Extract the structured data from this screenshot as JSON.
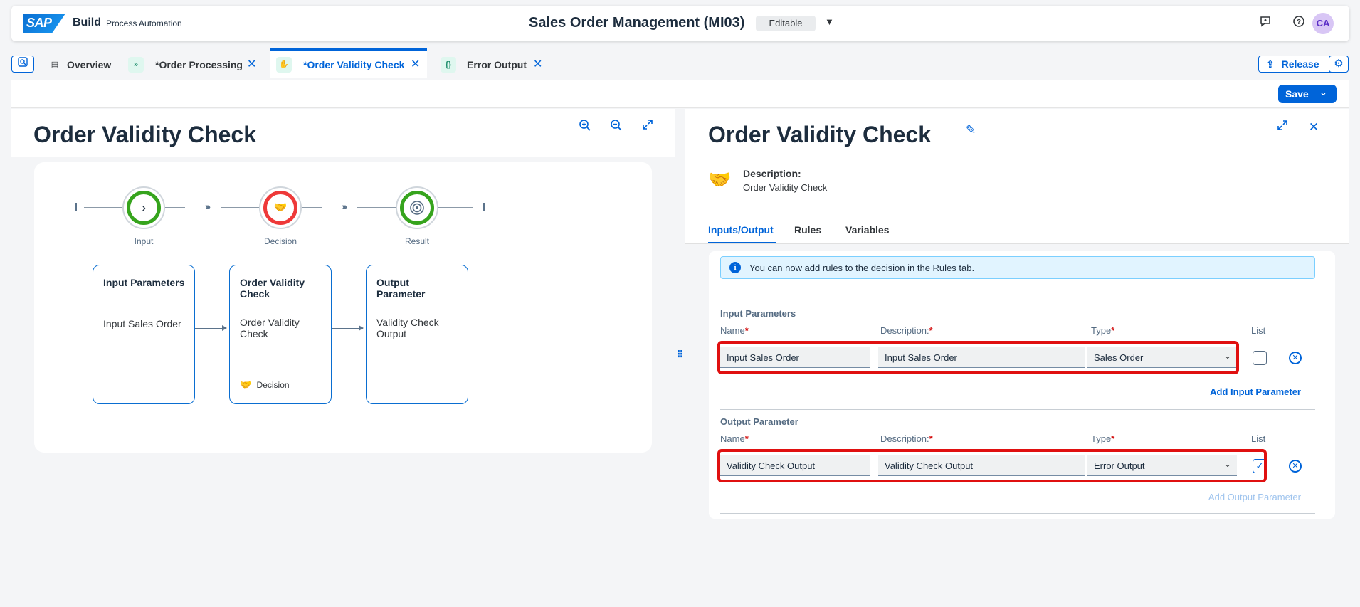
{
  "shell": {
    "logo": "SAP",
    "build": "Build",
    "product": "Process Automation",
    "title": "Sales Order Management (MI03)",
    "badge": "Editable",
    "avatar": "CA"
  },
  "tabs": [
    {
      "label": "Overview",
      "icon": "overview-icon"
    },
    {
      "label": "*Order Processing",
      "icon": "process-icon"
    },
    {
      "label": "*Order Validity Check",
      "icon": "decision-icon"
    },
    {
      "label": "Error Output",
      "icon": "data-type-icon"
    }
  ],
  "toolbar": {
    "release": "Release",
    "save": "Save"
  },
  "left": {
    "title": "Order Validity Check",
    "steps": [
      {
        "label": "Input"
      },
      {
        "label": "Decision"
      },
      {
        "label": "Result"
      }
    ],
    "cards": [
      {
        "title": "Input Parameters",
        "body": "Input Sales Order",
        "footer": ""
      },
      {
        "title": "Order Validity Check",
        "body": "Order Validity Check",
        "footer": "Decision"
      },
      {
        "title": "Output Parameter",
        "body": "Validity Check Output",
        "footer": ""
      }
    ]
  },
  "right": {
    "title": "Order Validity Check",
    "description_label": "Description:",
    "description_value": "Order Validity Check",
    "tabs": [
      "Inputs/Output",
      "Rules",
      "Variables"
    ],
    "info": "You can now add rules to the decision in the Rules tab.",
    "labels": {
      "name": "Name",
      "description": "Description:",
      "type": "Type",
      "list": "List"
    },
    "input_section": "Input Parameters",
    "input_row": {
      "name": "Input Sales Order",
      "description": "Input Sales Order",
      "type": "Sales Order",
      "list": false
    },
    "add_input": "Add Input Parameter",
    "output_section": "Output Parameter",
    "output_row": {
      "name": "Validity Check Output",
      "description": "Validity Check Output",
      "type": "Error Output",
      "list": true
    },
    "add_output": "Add Output Parameter"
  },
  "colors": {
    "accent": "#0064d9",
    "success": "#36a41d",
    "error": "#ee3939",
    "highlight": "#e01010"
  }
}
